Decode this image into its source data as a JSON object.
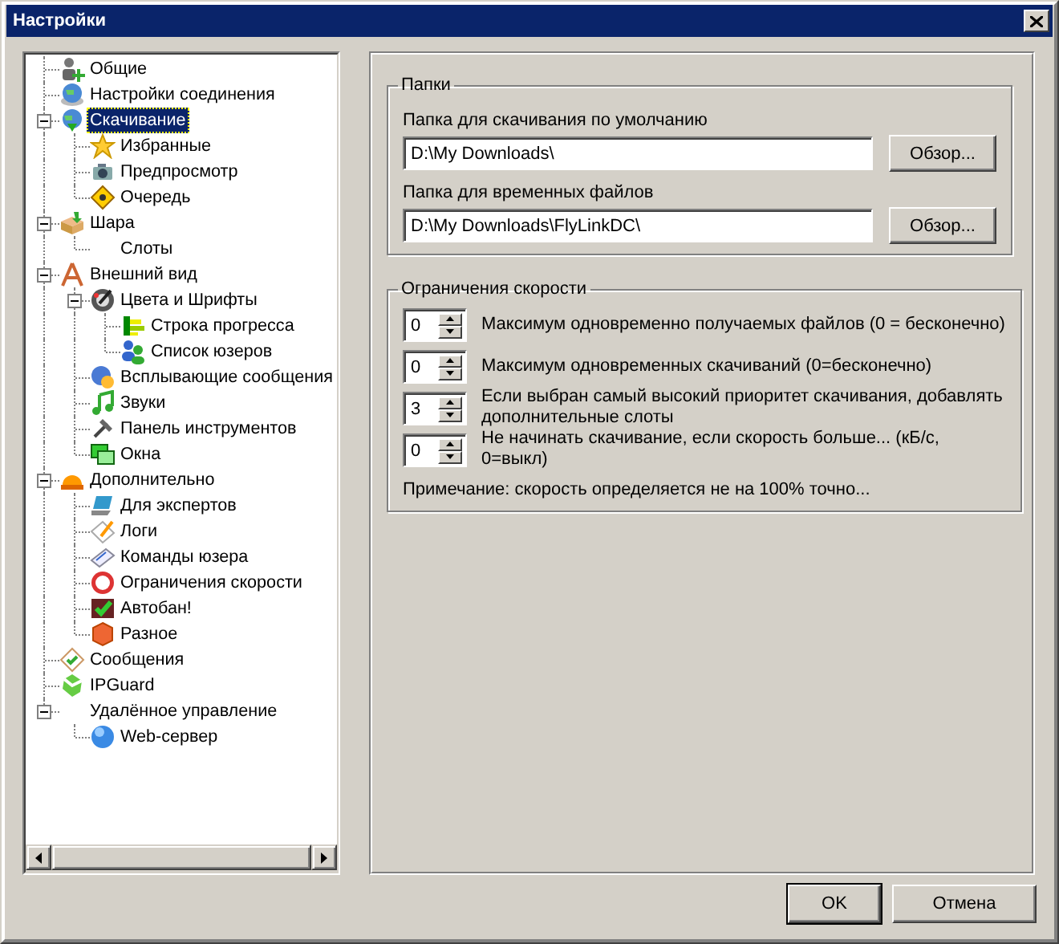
{
  "window": {
    "title": "Настройки"
  },
  "tree": {
    "items": [
      {
        "label": "Общие",
        "selected": false
      },
      {
        "label": "Настройки соединения",
        "selected": false
      },
      {
        "label": "Скачивание",
        "selected": true,
        "expanded": true,
        "children": [
          {
            "label": "Избранные",
            "selected": false
          },
          {
            "label": "Предпросмотр",
            "selected": false
          },
          {
            "label": "Очередь",
            "selected": false
          }
        ]
      },
      {
        "label": "Шара",
        "selected": false,
        "expanded": true,
        "children": [
          {
            "label": "Слоты",
            "selected": false
          }
        ]
      },
      {
        "label": "Внешний вид",
        "selected": false,
        "expanded": true,
        "children": [
          {
            "label": "Цвета и Шрифты",
            "selected": false,
            "expanded": true,
            "children": [
              {
                "label": "Строка прогресса",
                "selected": false
              },
              {
                "label": "Список юзеров",
                "selected": false
              }
            ]
          },
          {
            "label": "Всплывающие сообщения",
            "selected": false
          },
          {
            "label": "Звуки",
            "selected": false
          },
          {
            "label": "Панель инструментов",
            "selected": false
          },
          {
            "label": "Окна",
            "selected": false
          }
        ]
      },
      {
        "label": "Дополнительно",
        "selected": false,
        "expanded": true,
        "children": [
          {
            "label": "Для экспертов",
            "selected": false
          },
          {
            "label": "Логи",
            "selected": false
          },
          {
            "label": "Команды юзера",
            "selected": false
          },
          {
            "label": "Ограничения скорости",
            "selected": false
          },
          {
            "label": "Автобан!",
            "selected": false
          },
          {
            "label": "Разное",
            "selected": false
          }
        ]
      },
      {
        "label": "Сообщения",
        "selected": false
      },
      {
        "label": "IPGuard",
        "selected": false
      },
      {
        "label": "Удалённое управление",
        "selected": false,
        "expanded": true,
        "children": [
          {
            "label": "Web-сервер",
            "selected": false
          }
        ]
      }
    ]
  },
  "folders": {
    "title": "Папки",
    "rows": [
      {
        "label": "Папка для скачивания по умолчанию",
        "value": "D:\\My Downloads\\",
        "button": "Обзор..."
      },
      {
        "label": "Папка для временных файлов",
        "value": "D:\\My Downloads\\FlyLinkDC\\",
        "button": "Обзор..."
      }
    ]
  },
  "speed": {
    "title": "Ограничения скорости",
    "rows": [
      {
        "value": "0",
        "text": "Максимум одновременно получаемых файлов (0 = бесконечно)"
      },
      {
        "value": "0",
        "text": "Максимум одновременных скачиваний (0=бесконечно)"
      },
      {
        "value": "3",
        "text": "Если выбран самый высокий приоритет скачивания, добавлять дополнительные слоты"
      },
      {
        "value": "0",
        "text": "Не начинать скачивание, если скорость больше... (кБ/с, 0=выкл)"
      }
    ],
    "note": "Примечание: скорость определяется не на 100% точно..."
  },
  "buttons": [
    {
      "label": "OK",
      "default": true
    },
    {
      "label": "Отмена",
      "default": false
    }
  ]
}
